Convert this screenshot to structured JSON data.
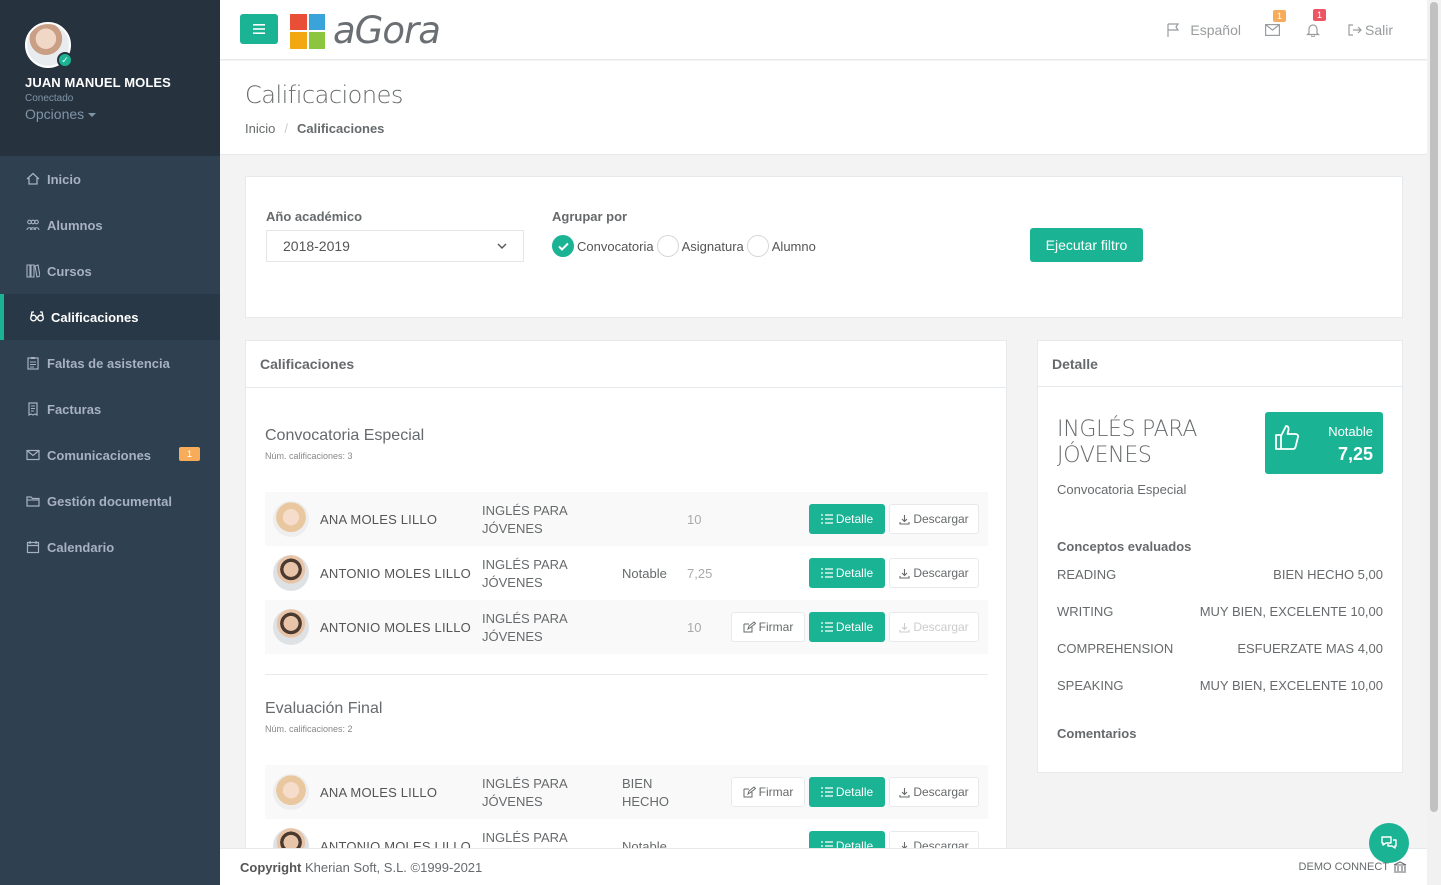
{
  "user": {
    "name": "JUAN MANUEL MOLES",
    "status": "Conectado",
    "options": "Opciones"
  },
  "nav": [
    {
      "label": "Inicio",
      "icon": "home-icon"
    },
    {
      "label": "Alumnos",
      "icon": "students-icon"
    },
    {
      "label": "Cursos",
      "icon": "books-icon"
    },
    {
      "label": "Calificaciones",
      "icon": "glasses-icon",
      "active": true
    },
    {
      "label": "Faltas de asistencia",
      "icon": "clipboard-icon"
    },
    {
      "label": "Facturas",
      "icon": "invoice-icon"
    },
    {
      "label": "Comunicaciones",
      "icon": "envelope-icon",
      "badge": "1"
    },
    {
      "label": "Gestión documental",
      "icon": "folder-icon"
    },
    {
      "label": "Calendario",
      "icon": "calendar-icon"
    }
  ],
  "topbar": {
    "logo": "aGora",
    "language": "Español",
    "mail_badge": "1",
    "bell_badge": "1",
    "logout": "Salir"
  },
  "heading": {
    "title": "Calificaciones",
    "crumb_home": "Inicio",
    "crumb_sep": "/",
    "crumb_current": "Calificaciones"
  },
  "filter": {
    "year_label": "Año académico",
    "year_value": "2018-2019",
    "group_label": "Agrupar por",
    "options": [
      "Convocatoria",
      "Asignatura",
      "Alumno"
    ],
    "selected": "Convocatoria",
    "run_button": "Ejecutar filtro"
  },
  "grades_panel": {
    "title": "Calificaciones",
    "groups": [
      {
        "title": "Convocatoria Especial",
        "count": "Núm. calificaciones: 3",
        "rows": [
          {
            "student": "ANA MOLES LILLO",
            "subject": "INGLÉS PARA JÓVENES",
            "qualification": "",
            "grade": "10",
            "sign": false,
            "download": true
          },
          {
            "student": "ANTONIO MOLES LILLO",
            "subject": "INGLÉS PARA JÓVENES",
            "qualification": "Notable",
            "grade": "7,25",
            "sign": false,
            "download": true
          },
          {
            "student": "ANTONIO MOLES LILLO",
            "subject": "INGLÉS PARA JÓVENES",
            "qualification": "",
            "grade": "10",
            "sign": true,
            "download": false
          }
        ]
      },
      {
        "title": "Evaluación Final",
        "count": "Núm. calificaciones: 2",
        "rows": [
          {
            "student": "ANA MOLES LILLO",
            "subject": "INGLÉS PARA JÓVENES",
            "qualification": "BIEN HECHO",
            "grade": "",
            "sign": true,
            "download": true
          },
          {
            "student": "ANTONIO MOLES LILLO",
            "subject": "INGLÉS PARA",
            "qualification": "Notable",
            "grade": "",
            "sign": false,
            "download": true
          }
        ]
      }
    ],
    "buttons": {
      "detail": "Detalle",
      "download": "Descargar",
      "sign": "Firmar"
    }
  },
  "detail_panel": {
    "title": "Detalle",
    "subject": "INGLÉS PARA JÓVENES",
    "convocatoria": "Convocatoria Especial",
    "qualification": "Notable",
    "grade": "7,25",
    "concepts_title": "Conceptos evaluados",
    "concepts": [
      {
        "name": "READING",
        "value": "BIEN HECHO 5,00"
      },
      {
        "name": "WRITING",
        "value": "MUY BIEN, EXCELENTE 10,00"
      },
      {
        "name": "COMPREHENSION",
        "value": "ESFUERZATE MAS 4,00"
      },
      {
        "name": "SPEAKING",
        "value": "MUY BIEN, EXCELENTE 10,00"
      }
    ],
    "comments_title": "Comentarios"
  },
  "footer": {
    "copyright_label": "Copyright",
    "copyright_text": "Kherian Soft, S.L. ©1999-2021",
    "demo": "DEMO CONNECT"
  },
  "colors": {
    "accent": "#1ab394",
    "sidebar": "#2f4050",
    "warning": "#f8ac59",
    "danger": "#ed5565"
  }
}
